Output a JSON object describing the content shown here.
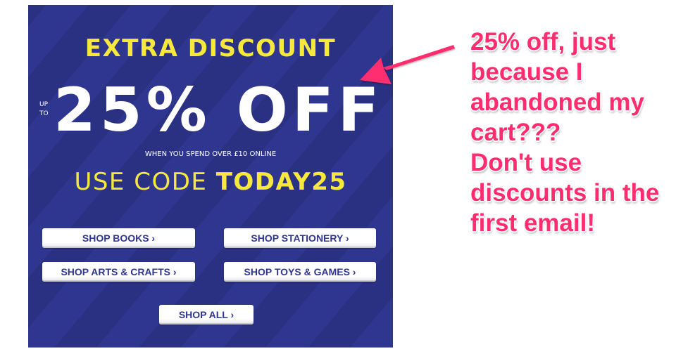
{
  "banner": {
    "headline": "EXTRA DISCOUNT",
    "up_to": [
      "UP",
      "TO"
    ],
    "big_offer": "25% OFF",
    "condition": "WHEN YOU SPEND OVER £10 ONLINE",
    "code_prefix": "USE CODE ",
    "code": "TODAY25",
    "colors": {
      "background": "#2f3690",
      "stripe": "#2b3182",
      "yellow": "#f6e83c",
      "white": "#ffffff",
      "button_text": "#2f3690"
    },
    "buttons": [
      {
        "label": "SHOP BOOKS ›"
      },
      {
        "label": "SHOP STATIONERY ›"
      },
      {
        "label": "SHOP ARTS & CRAFTS ›"
      },
      {
        "label": "SHOP TOYS & GAMES ›"
      },
      {
        "label": "SHOP ALL ›"
      }
    ]
  },
  "annotation": {
    "color": "#ff2d6f",
    "arrow_icon": "arrow-pointing-left-icon",
    "lines": [
      "25% off, just",
      "because I",
      "abandoned my",
      "cart???",
      "Don't use",
      "discounts in the",
      "first email!"
    ]
  }
}
